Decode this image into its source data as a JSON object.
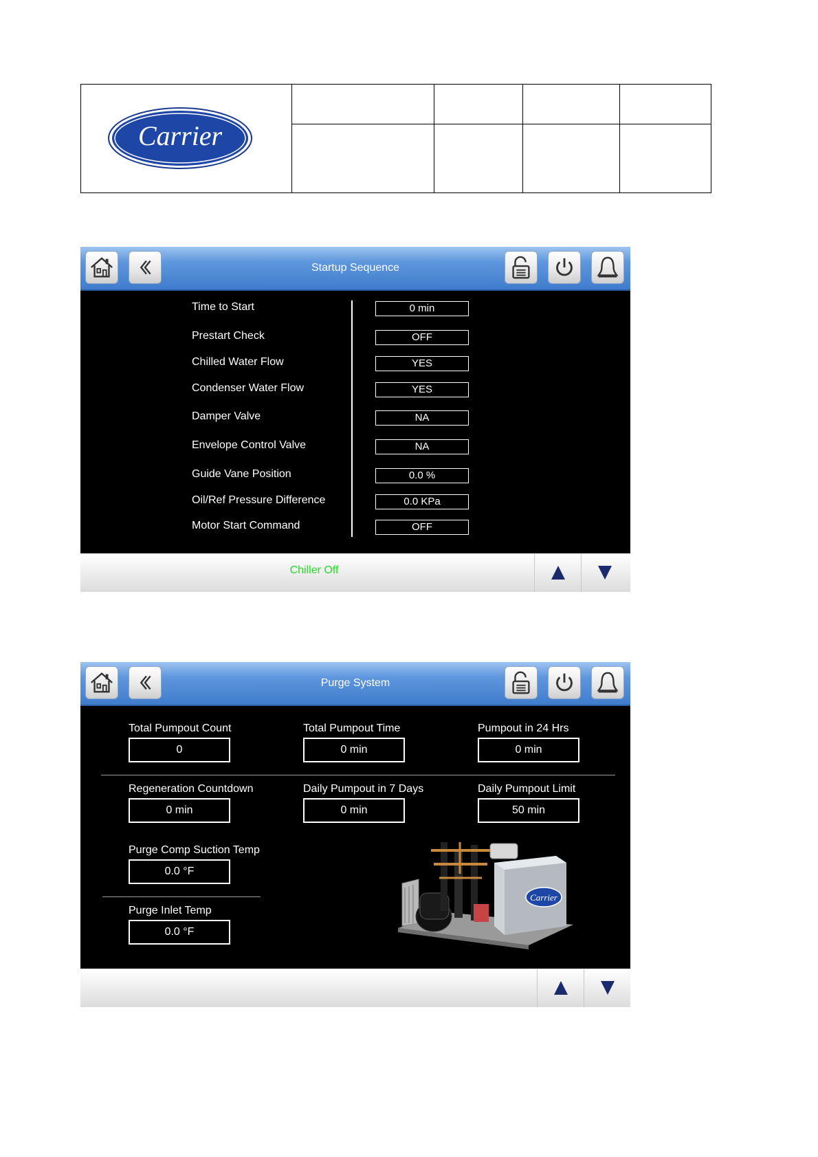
{
  "brand": {
    "logo_text": "Carrier"
  },
  "icons": {
    "home": "home-icon",
    "back": "chevron-left-icon",
    "login": "padlock-login-icon",
    "power": "power-icon",
    "alarm": "bell-icon",
    "up": "triangle-up-icon",
    "down": "triangle-down-icon"
  },
  "colors": {
    "header_blue": "#4a86d4",
    "status_green": "#22dd22",
    "arrow_navy": "#1a2a6c"
  },
  "startup": {
    "title": "Startup Sequence",
    "status": "Chiller Off",
    "rows": [
      {
        "label": "Time to Start",
        "value": "0 min"
      },
      {
        "label": "Prestart Check",
        "value": "OFF"
      },
      {
        "label": "Chilled Water Flow",
        "value": "YES"
      },
      {
        "label": "Condenser Water Flow",
        "value": "YES"
      },
      {
        "label": "Damper Valve",
        "value": "NA"
      },
      {
        "label": "Envelope Control Valve",
        "value": "NA"
      },
      {
        "label": "Guide Vane Position",
        "value": "0.0 %"
      },
      {
        "label": "Oil/Ref Pressure Difference",
        "value": "0.0 KPa"
      },
      {
        "label": "Motor Start Command",
        "value": "OFF"
      }
    ]
  },
  "purge": {
    "title": "Purge System",
    "fields": [
      {
        "label": "Total Pumpout Count",
        "value": "0"
      },
      {
        "label": "Total Pumpout Time",
        "value": "0 min"
      },
      {
        "label": "Pumpout in 24 Hrs",
        "value": "0 min"
      },
      {
        "label": "Regeneration Countdown",
        "value": "0 min"
      },
      {
        "label": "Daily Pumpout in 7 Days",
        "value": "0 min"
      },
      {
        "label": "Daily Pumpout Limit",
        "value": "50 min"
      },
      {
        "label": "Purge Comp Suction Temp",
        "value": "0.0 °F"
      },
      {
        "label": "Purge Inlet Temp",
        "value": "0.0 °F"
      }
    ],
    "unit_logo_text": "Carrier"
  }
}
